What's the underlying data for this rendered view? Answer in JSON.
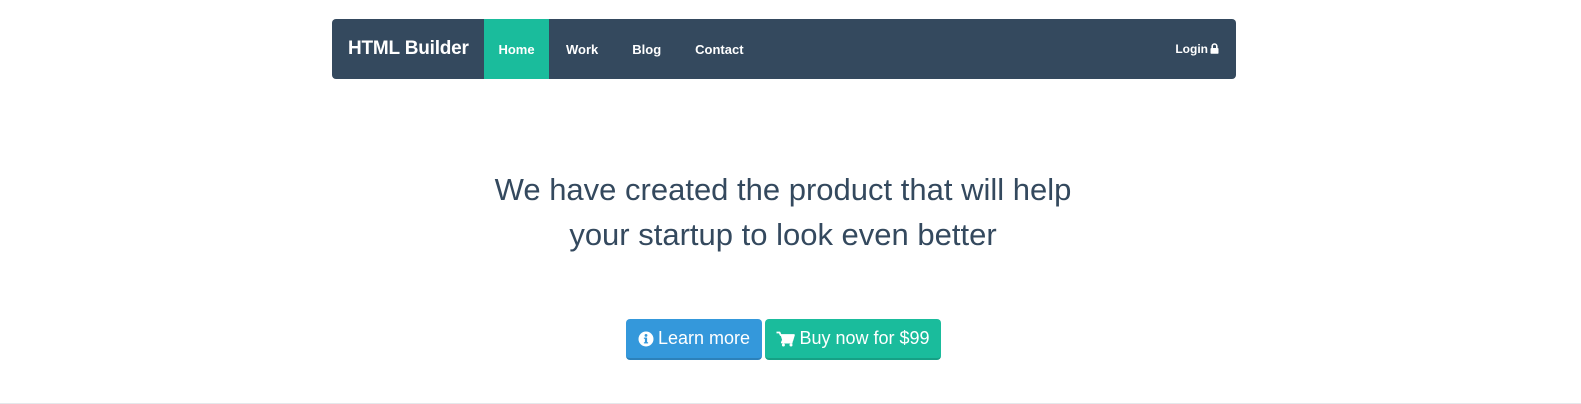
{
  "navbar": {
    "brand": "HTML Builder",
    "items": [
      {
        "label": "Home"
      },
      {
        "label": "Work"
      },
      {
        "label": "Blog"
      },
      {
        "label": "Contact"
      }
    ],
    "login_label": "Login",
    "login_icon": "lock-icon"
  },
  "hero": {
    "headline_line1": "We have created the product that will help",
    "headline_line2": "your startup to look even better"
  },
  "buttons": {
    "learn_more": {
      "label": "Learn more",
      "icon": "info-circle-icon"
    },
    "buy": {
      "label": "Buy now for $99",
      "icon": "cart-icon"
    }
  },
  "colors": {
    "navbar_bg": "#34495e",
    "active_accent": "#1abc9c",
    "info_button": "#3498db",
    "text_dark": "#34495e"
  }
}
